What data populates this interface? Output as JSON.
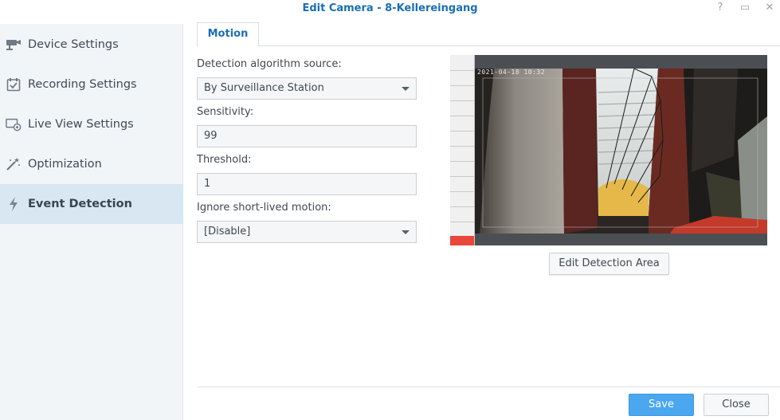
{
  "window": {
    "title": "Edit Camera - 8-Kellereingang",
    "help_icon": "?",
    "maximize_icon": "▭",
    "close_icon": "✕"
  },
  "sidebar": {
    "items": [
      {
        "label": "Device Settings",
        "icon": "camera-icon"
      },
      {
        "label": "Recording Settings",
        "icon": "calendar-check-icon"
      },
      {
        "label": "Live View Settings",
        "icon": "live-view-icon"
      },
      {
        "label": "Optimization",
        "icon": "magic-wand-icon"
      },
      {
        "label": "Event Detection",
        "icon": "lightning-icon",
        "active": true
      }
    ]
  },
  "tabs": [
    {
      "label": "Motion",
      "active": true
    }
  ],
  "form": {
    "source_label": "Detection algorithm source:",
    "source_value": "By Surveillance Station",
    "sensitivity_label": "Sensitivity:",
    "sensitivity_value": "99",
    "threshold_label": "Threshold:",
    "threshold_value": "1",
    "ignore_label": "Ignore short-lived motion:",
    "ignore_value": "[Disable]"
  },
  "preview": {
    "timestamp": "2021-04-18 10:32",
    "meter_level_percent": 5,
    "meter_color": "#e8473a",
    "edit_button": "Edit Detection Area"
  },
  "footer": {
    "save": "Save",
    "close": "Close"
  },
  "colors": {
    "accent": "#1a6fb4",
    "save_button": "#4aa7f0",
    "active_sidebar": "#d8e7f1"
  }
}
